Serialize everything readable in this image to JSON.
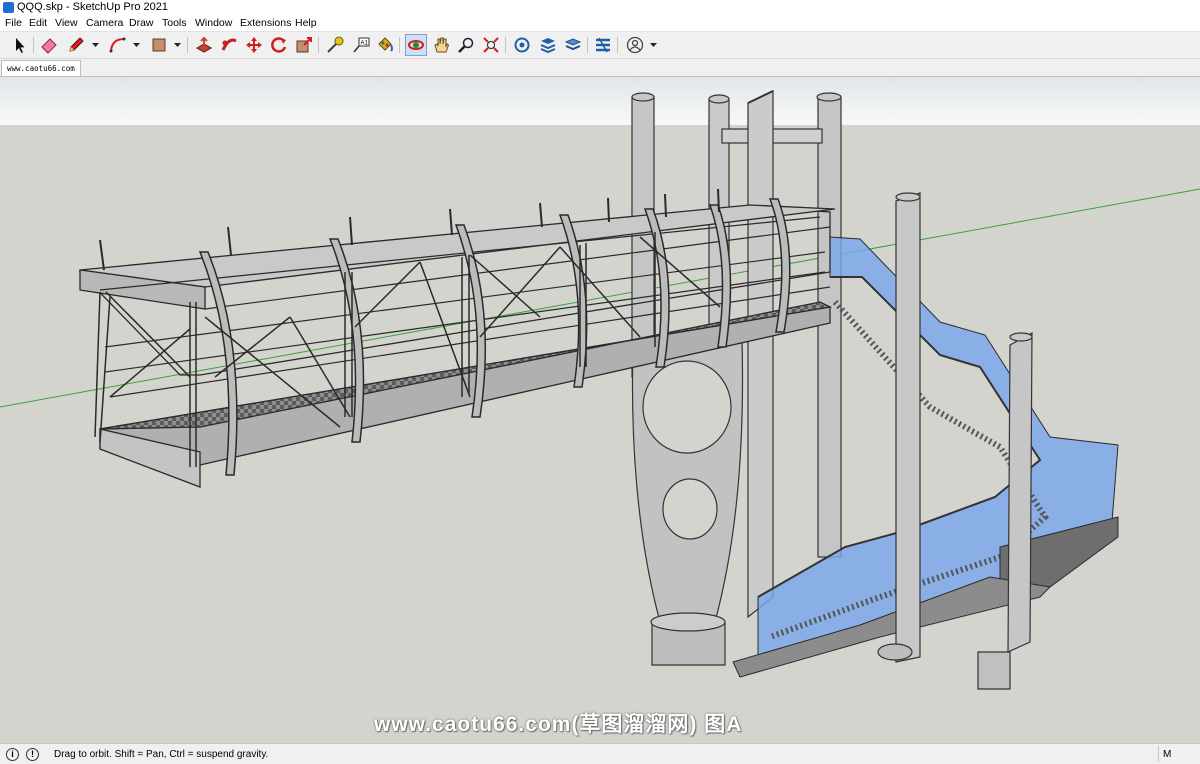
{
  "window": {
    "title": "QQQ.skp - SketchUp Pro 2021"
  },
  "menu": [
    "File",
    "Edit",
    "View",
    "Camera",
    "Draw",
    "Tools",
    "Window",
    "Extensions",
    "Help"
  ],
  "toolbar": {
    "tools": [
      {
        "name": "select-tool",
        "icon": "arrow-cursor-icon"
      },
      {
        "name": "eraser-tool",
        "icon": "eraser-icon"
      },
      {
        "name": "pencil-tool",
        "icon": "pencil-icon"
      },
      {
        "name": "arc-tool",
        "icon": "arc-icon"
      },
      {
        "name": "shape-tool",
        "icon": "rectangle-icon"
      },
      {
        "name": "push-pull-tool",
        "icon": "push-pull-icon"
      },
      {
        "name": "follow-me-tool",
        "icon": "follow-me-icon"
      },
      {
        "name": "move-tool",
        "icon": "move-icon"
      },
      {
        "name": "rotate-tool",
        "icon": "rotate-icon"
      },
      {
        "name": "scale-tool",
        "icon": "scale-icon"
      },
      {
        "name": "tape-measure-tool",
        "icon": "tape-measure-icon"
      },
      {
        "name": "text-tool",
        "icon": "text-label-icon"
      },
      {
        "name": "paint-bucket-tool",
        "icon": "paint-bucket-icon"
      },
      {
        "name": "orbit-tool",
        "icon": "orbit-icon",
        "active": true
      },
      {
        "name": "pan-tool",
        "icon": "hand-icon"
      },
      {
        "name": "zoom-tool",
        "icon": "magnifier-icon"
      },
      {
        "name": "zoom-extents-tool",
        "icon": "zoom-extents-icon"
      },
      {
        "name": "warehouse-button",
        "icon": "warehouse-icon"
      },
      {
        "name": "extension-warehouse-button",
        "icon": "extension-warehouse-icon"
      },
      {
        "name": "layout-button",
        "icon": "layout-icon"
      },
      {
        "name": "extension-manager-button",
        "icon": "extension-manager-icon"
      },
      {
        "name": "account-button",
        "icon": "user-account-icon"
      }
    ]
  },
  "tab": {
    "label": "www.caotu66.com"
  },
  "viewport": {
    "sky_color": "#f2f4f5",
    "ground_color": "#d4d4cf",
    "glass_color": "#7aa7ec",
    "steel_color": "#c6c6c6"
  },
  "watermark": {
    "text": "www.caotu66.com(草图溜溜网) 图A"
  },
  "status": {
    "icons": [
      "info-icon",
      "exclamation-icon"
    ],
    "hint": "Drag to orbit. Shift = Pan, Ctrl = suspend gravity.",
    "measurements_label": "M"
  }
}
